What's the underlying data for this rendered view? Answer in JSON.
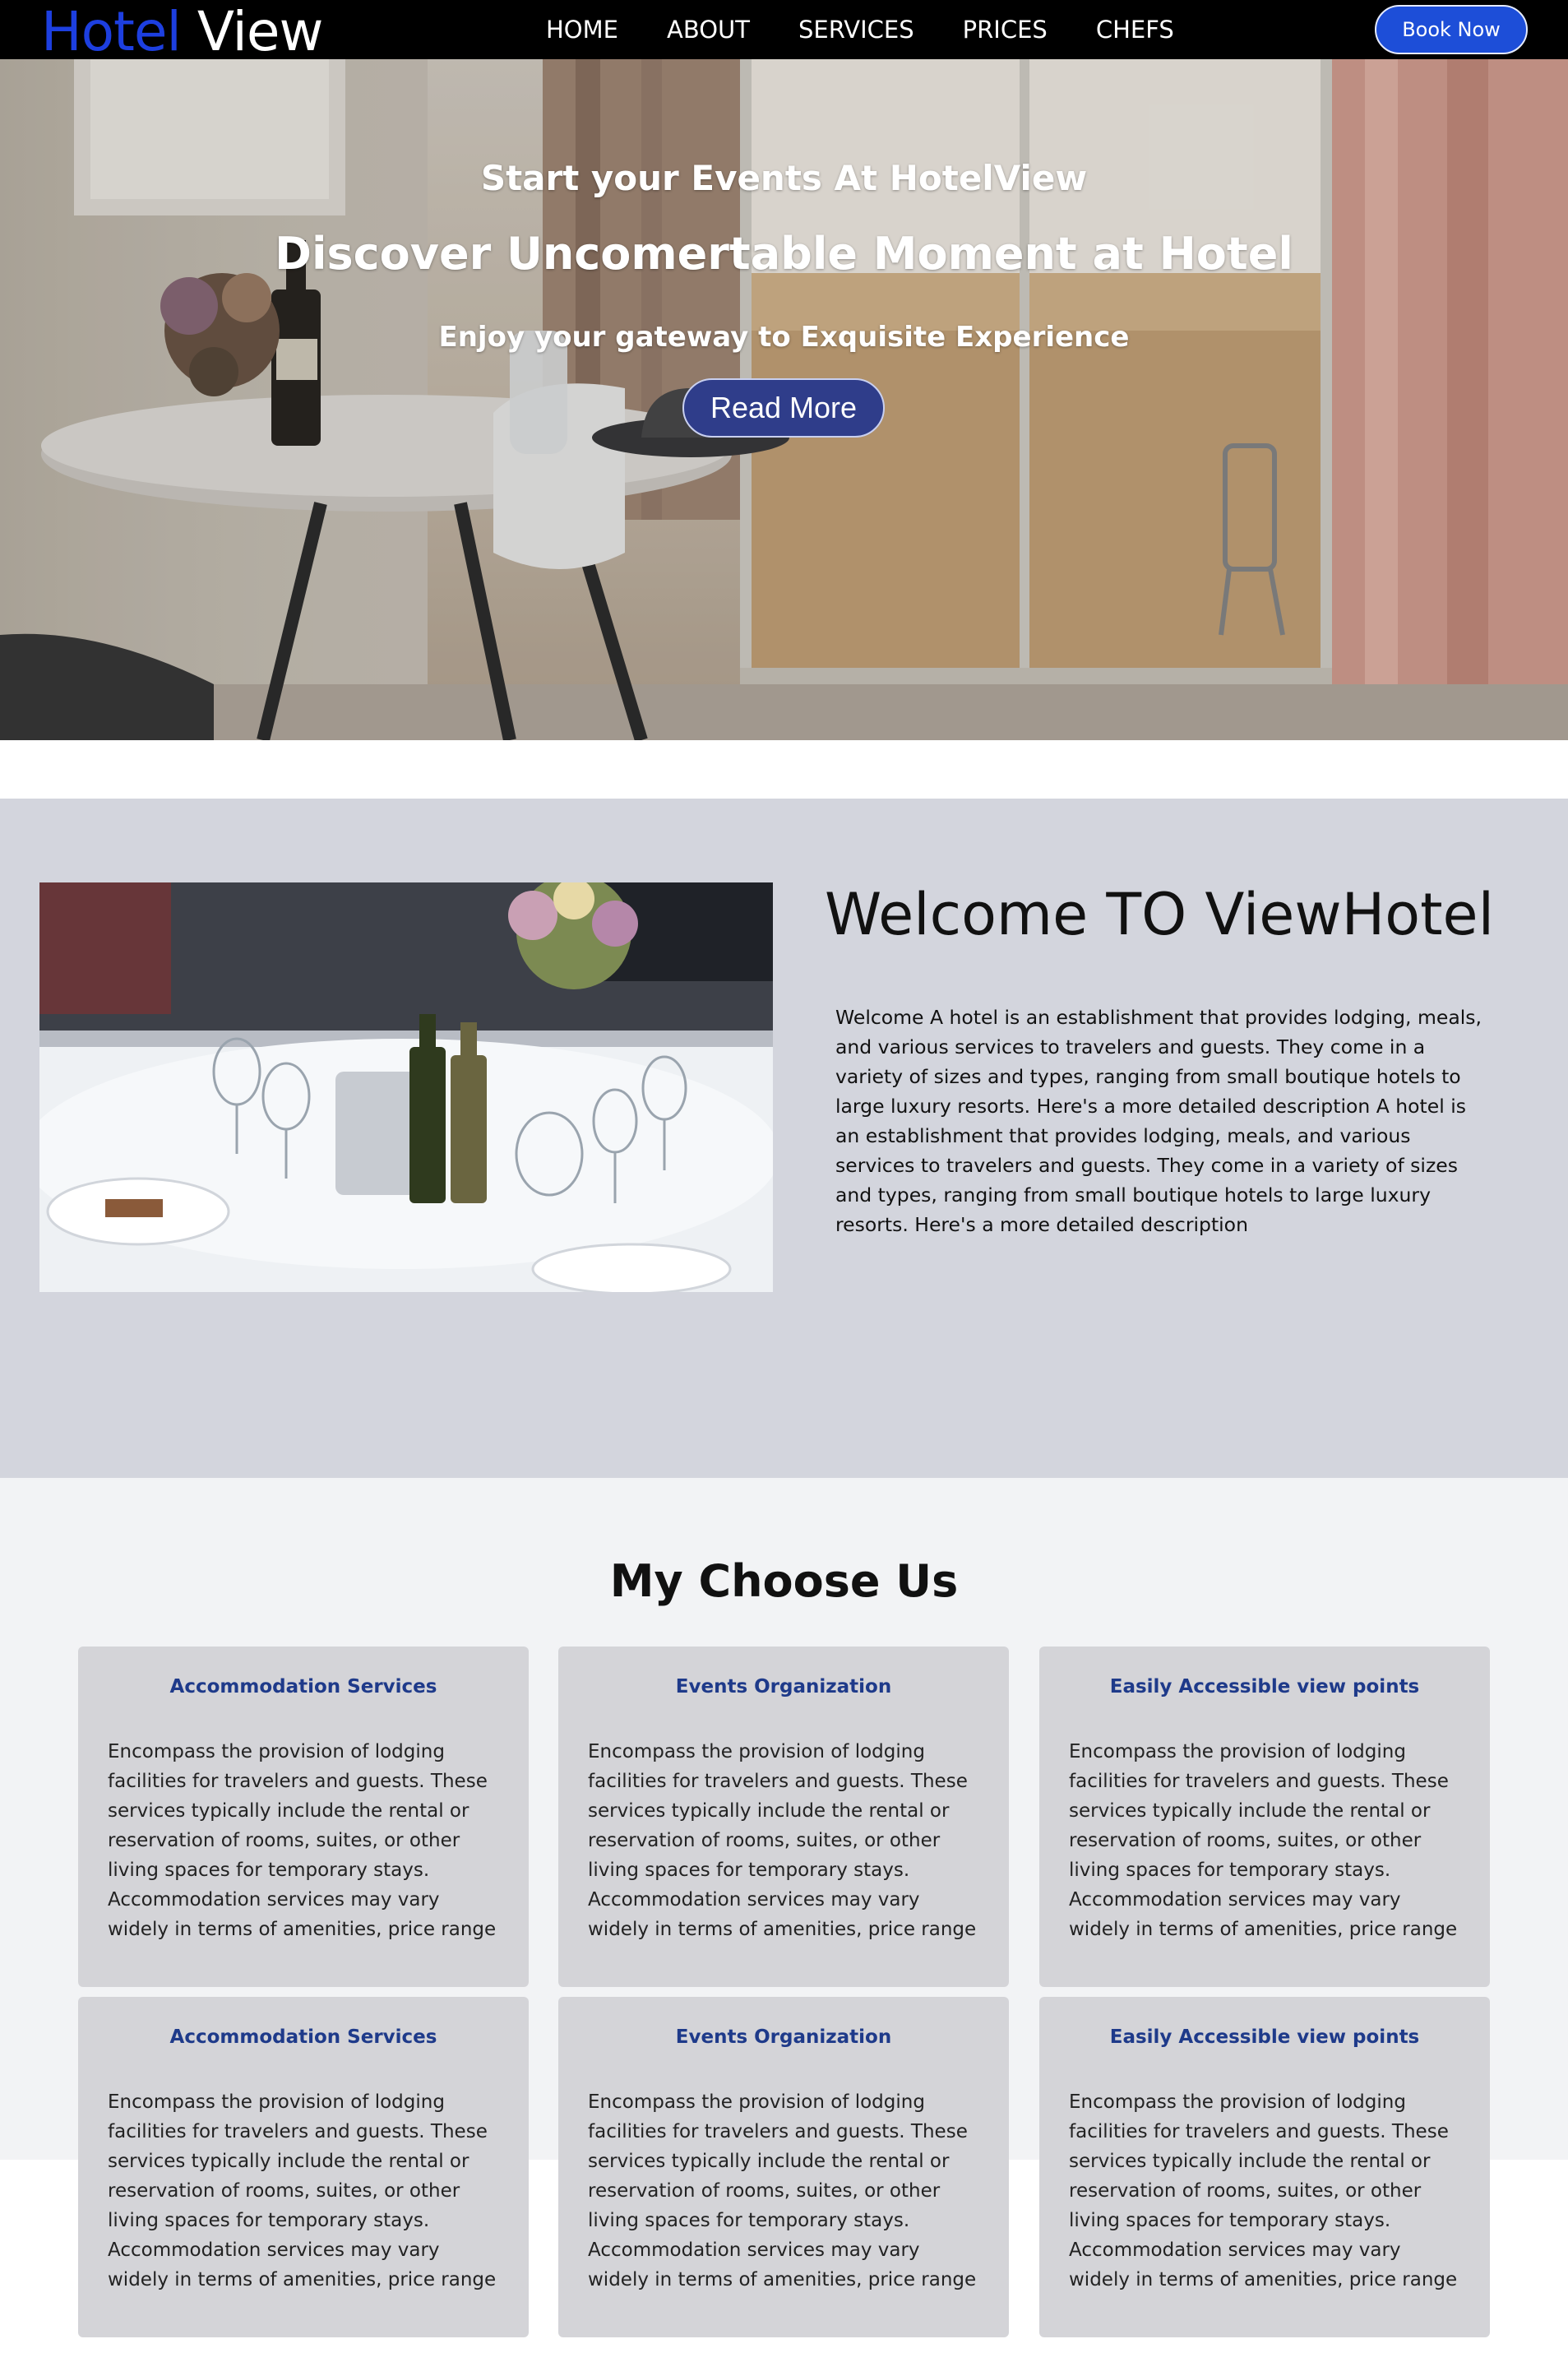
{
  "nav": {
    "logo_part1": "Hotel",
    "logo_part2": "View",
    "links": [
      "HOME",
      "ABOUT",
      "SERVICES",
      "PRICES",
      "CHEFS"
    ],
    "book_button": "Book Now"
  },
  "hero": {
    "kicker": "Start your Events At HotelView",
    "title": "Discover Uncomertable Moment at Hotel",
    "tagline": "Enjoy your gateway to Exquisite Experience",
    "button": "Read More"
  },
  "welcome": {
    "title": "Welcome TO ViewHotel",
    "text": "Welcome A hotel is an establishment that provides lodging, meals, and various services to travelers and guests. They come in a variety of sizes and types, ranging from small boutique hotels to large luxury resorts. Here's a more detailed description A hotel is an establishment that provides lodging, meals, and various services to travelers and guests. They come in a variety of sizes and types, ranging from small boutique hotels to large luxury resorts. Here's a more detailed description"
  },
  "choose": {
    "title": "My Choose Us",
    "cards": [
      {
        "title": "Accommodation Services",
        "text": "Encompass the provision of lodging facilities for travelers and guests. These services typically include the rental or reservation of rooms, suites, or other living spaces for temporary stays. Accommodation services may vary widely in terms of amenities, price range"
      },
      {
        "title": "Events Organization",
        "text": "Encompass the provision of lodging facilities for travelers and guests. These services typically include the rental or reservation of rooms, suites, or other living spaces for temporary stays. Accommodation services may vary widely in terms of amenities, price range"
      },
      {
        "title": "Easily Accessible view points",
        "text": "Encompass the provision of lodging facilities for travelers and guests. These services typically include the rental or reservation of rooms, suites, or other living spaces for temporary stays. Accommodation services may vary widely in terms of amenities, price range"
      },
      {
        "title": "Accommodation Services",
        "text": "Encompass the provision of lodging facilities for travelers and guests. These services typically include the rental or reservation of rooms, suites, or other living spaces for temporary stays. Accommodation services may vary widely in terms of amenities, price range"
      },
      {
        "title": "Events Organization",
        "text": "Encompass the provision of lodging facilities for travelers and guests. These services typically include the rental or reservation of rooms, suites, or other living spaces for temporary stays. Accommodation services may vary widely in terms of amenities, price range"
      },
      {
        "title": "Easily Accessible view points",
        "text": "Encompass the provision of lodging facilities for travelers and guests. These services typically include the rental or reservation of rooms, suites, or other living spaces for temporary stays. Accommodation services may vary widely in terms of amenities, price range"
      }
    ]
  },
  "colors": {
    "brand_blue": "#1d3fe0",
    "button_blue": "#1d4ed8",
    "hero_button": "#2f3d8a",
    "welcome_bg": "#d3d5dd",
    "choose_bg": "#f2f3f5",
    "card_bg": "#d4d4d8",
    "card_title": "#1e3a8a"
  }
}
